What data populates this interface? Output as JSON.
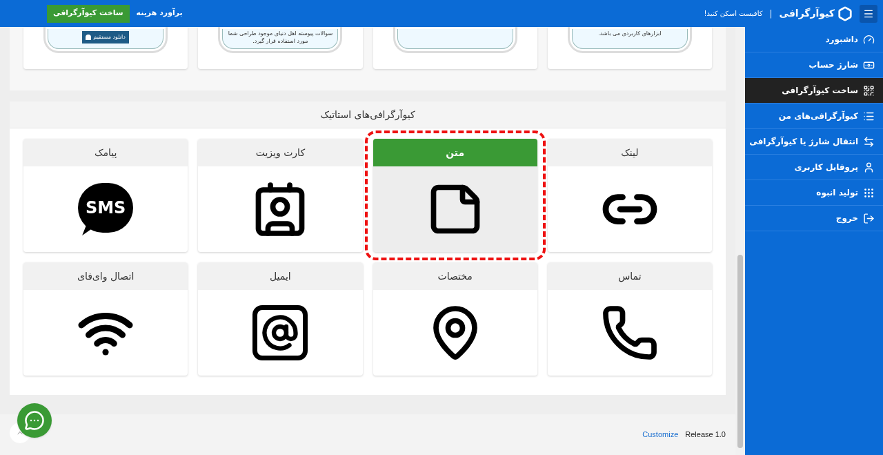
{
  "topbar": {
    "brand": "کیوآرگرافی",
    "separator": "|",
    "tagline": "کافیست اسکن کنید!",
    "create_button": "ساخت کیوآرگرافی",
    "estimate_link": "برآورد هزینه"
  },
  "sidebar": {
    "items": [
      {
        "label": "داشبورد",
        "selected": false
      },
      {
        "label": "شارژ حساب",
        "selected": false
      },
      {
        "label": "ساخت کیوآرگرافی",
        "selected": true
      },
      {
        "label": "کیوآرگرافی‌های من",
        "selected": false
      },
      {
        "label": "انتقال شارژ یا کیوآرگرافی",
        "selected": false
      },
      {
        "label": "پروفایل کاربری",
        "selected": false
      },
      {
        "label": "تولید انبوه",
        "selected": false
      },
      {
        "label": "خروج",
        "selected": false
      }
    ]
  },
  "preview_cards": [
    {
      "kind": "text",
      "lines": [
        "ابزارهای کاربردی می باشد."
      ]
    },
    {
      "kind": "blank"
    },
    {
      "kind": "text",
      "lines": [
        "سوالات پیوسته اهل دنیای موجود طراحی شما",
        "مورد استفاده قرار گیرد."
      ]
    },
    {
      "kind": "button",
      "button": "دانلود مستقیم"
    }
  ],
  "static_section": {
    "title": "کیوآرگرافی‌های استاتیک",
    "tiles": [
      {
        "label": "لینک",
        "selected": false
      },
      {
        "label": "متن",
        "selected": true
      },
      {
        "label": "کارت ویزیت",
        "selected": false
      },
      {
        "label": "پیامک",
        "icon_text": "SMS",
        "selected": false
      },
      {
        "label": "تماس",
        "selected": false
      },
      {
        "label": "مختصات",
        "selected": false
      },
      {
        "label": "ایمیل",
        "selected": false
      },
      {
        "label": "اتصال وای‌فای",
        "selected": false
      }
    ]
  },
  "footer": {
    "customize": "Customize",
    "release": "Release 1.0"
  }
}
